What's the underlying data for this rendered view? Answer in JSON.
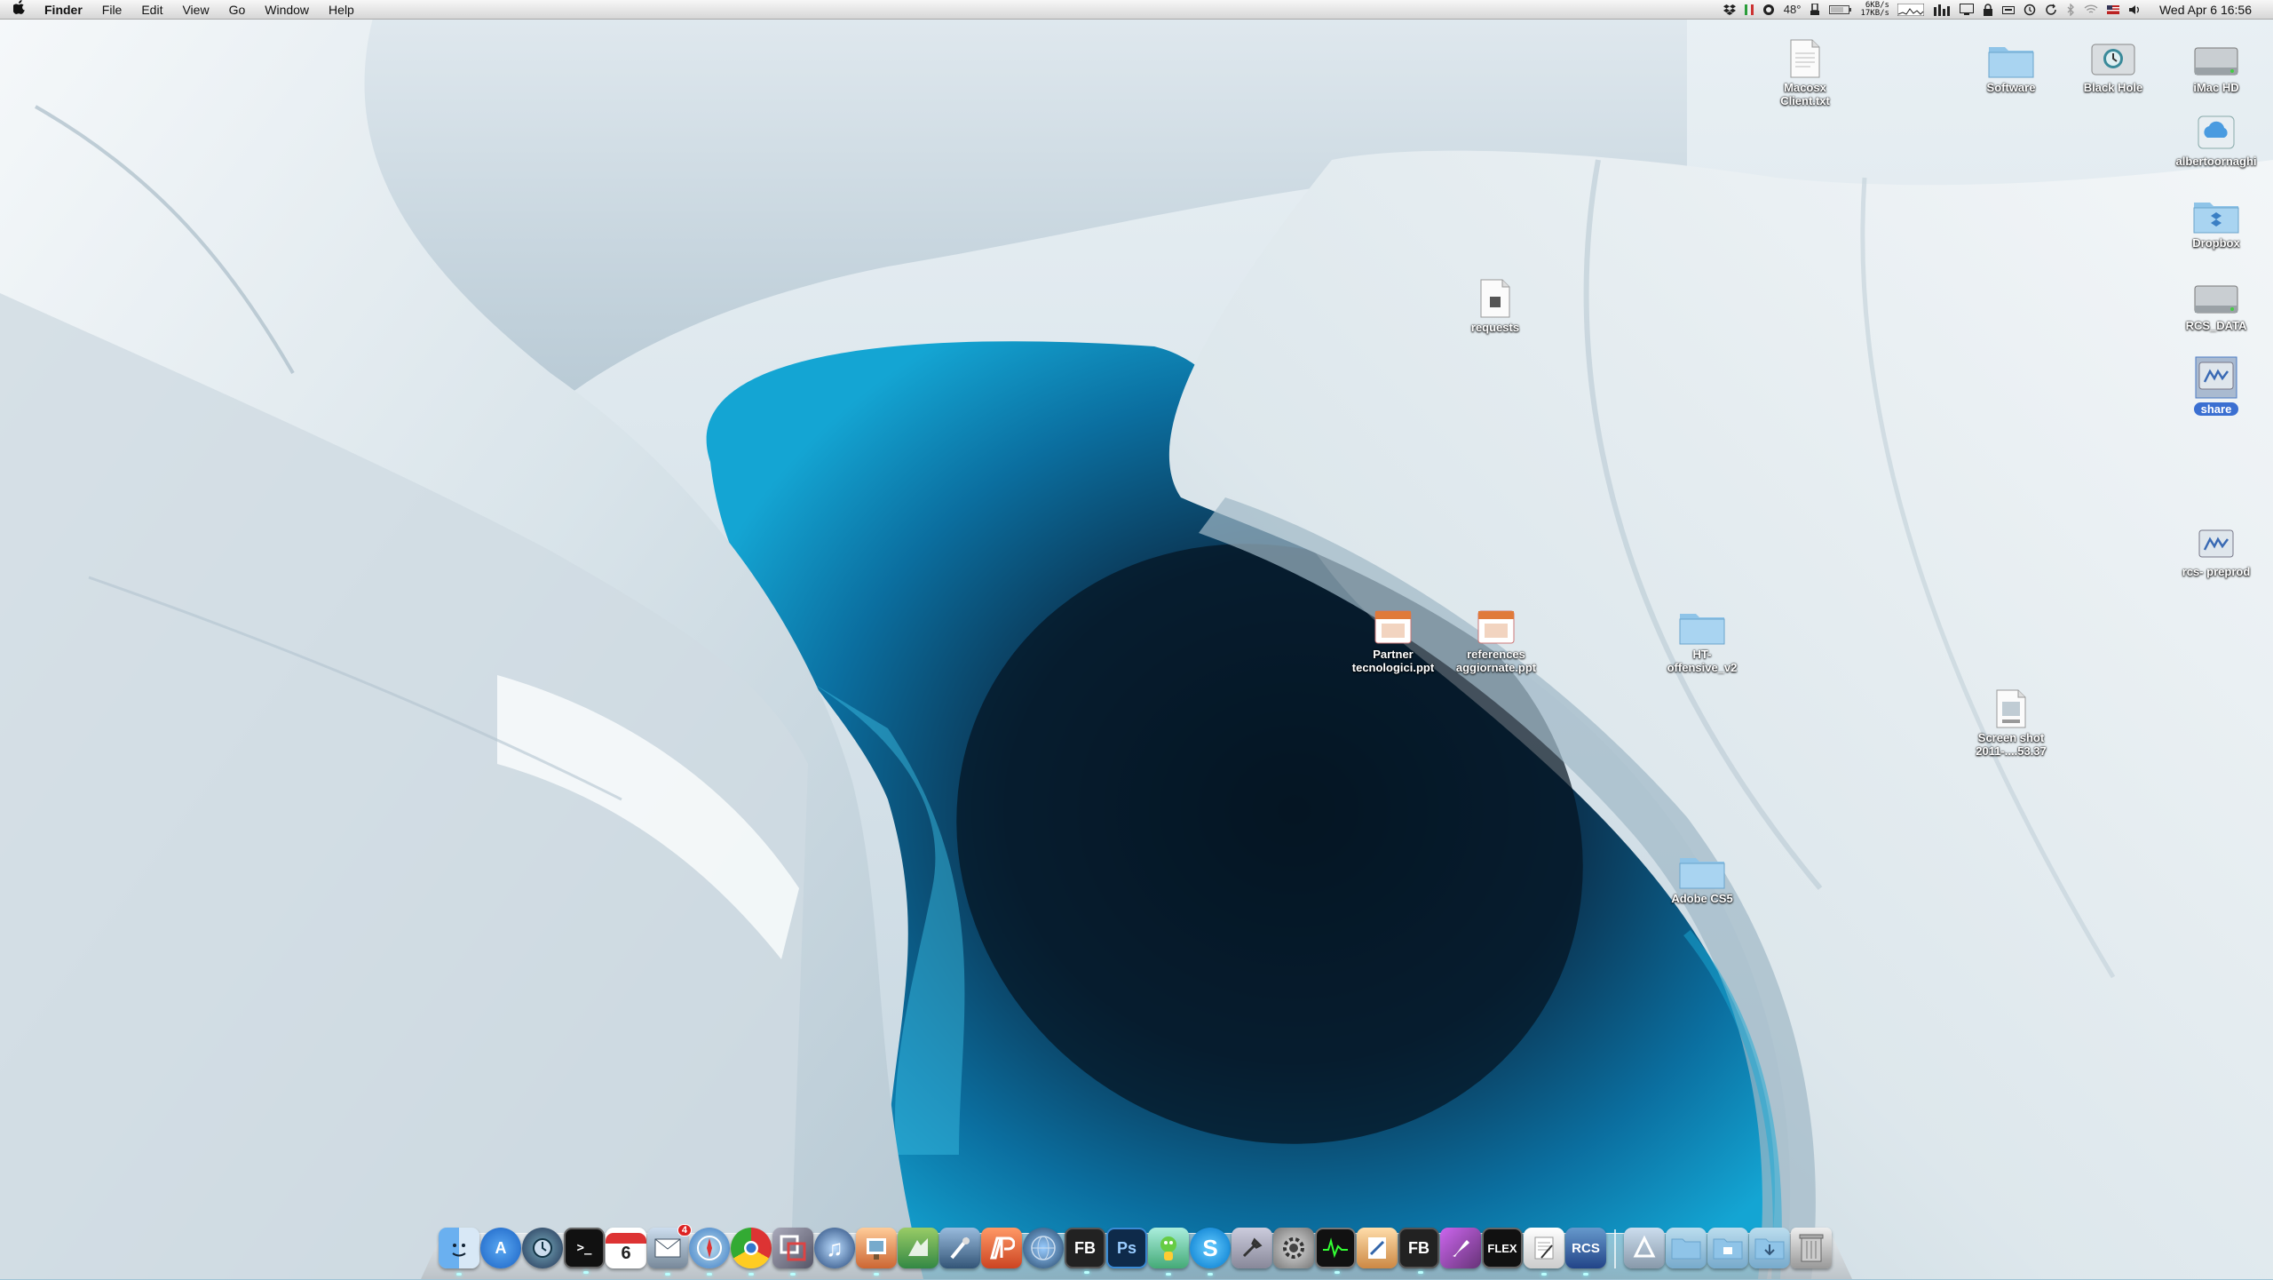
{
  "menubar": {
    "app_name": "Finder",
    "menus": [
      "File",
      "Edit",
      "View",
      "Go",
      "Window",
      "Help"
    ],
    "temperature": "48°",
    "net_up": "6KB/s",
    "net_down": "17KB/s",
    "clock": "Wed Apr 6  16:56"
  },
  "desktop": {
    "icons": [
      {
        "label": "Macosx\nClient.txt",
        "icon": "text-document-icon"
      },
      {
        "label": "Software",
        "icon": "folder-icon"
      },
      {
        "label": "Black Hole",
        "icon": "time-machine-drive-icon"
      },
      {
        "label": "iMac HD",
        "icon": "hard-drive-icon"
      },
      {
        "label": "albertoornaghi",
        "icon": "idisk-icon"
      },
      {
        "label": "Dropbox",
        "icon": "folder-icon"
      },
      {
        "label": "requests",
        "icon": "document-icon"
      },
      {
        "label": "RCS_DATA",
        "icon": "hard-drive-icon"
      },
      {
        "label": "share",
        "icon": "network-volume-icon"
      },
      {
        "label": "rcs- preprod",
        "icon": "network-volume-icon"
      },
      {
        "label": "Partner\ntecnologici.ppt",
        "icon": "presentation-file-icon"
      },
      {
        "label": "references\naggiornate.ppt",
        "icon": "presentation-file-icon"
      },
      {
        "label": "HT-\noffensive_v2",
        "icon": "folder-icon"
      },
      {
        "label": "Screen shot\n2011-....53.37",
        "icon": "png-file-icon"
      },
      {
        "label": "Adobe CS5",
        "icon": "folder-icon"
      }
    ]
  },
  "dock": {
    "calendar_day": "6",
    "mail_badge": "4",
    "items": [
      {
        "name": "Finder",
        "text": ""
      },
      {
        "name": "App Store",
        "text": "A"
      },
      {
        "name": "Time Machine",
        "text": ""
      },
      {
        "name": "Terminal",
        "text": ">_"
      },
      {
        "name": "iCal",
        "text": ""
      },
      {
        "name": "Mail",
        "text": ""
      },
      {
        "name": "Safari",
        "text": ""
      },
      {
        "name": "Chrome",
        "text": ""
      },
      {
        "name": "VMware",
        "text": ""
      },
      {
        "name": "iTunes",
        "text": "♫"
      },
      {
        "name": "Preview",
        "text": ""
      },
      {
        "name": "Coda",
        "text": ""
      },
      {
        "name": "Xcode",
        "text": ""
      },
      {
        "name": "Adobe Illustrator-like",
        "text": ""
      },
      {
        "name": "Network Globe",
        "text": ""
      },
      {
        "name": "Flash Builder",
        "text": "FB"
      },
      {
        "name": "Photoshop",
        "text": "Ps"
      },
      {
        "name": "Adium",
        "text": ""
      },
      {
        "name": "Skype",
        "text": "S"
      },
      {
        "name": "Utilities",
        "text": ""
      },
      {
        "name": "System Preferences",
        "text": ""
      },
      {
        "name": "Activity Monitor",
        "text": ""
      },
      {
        "name": "Pages",
        "text": ""
      },
      {
        "name": "Flash Builder 2",
        "text": "FB"
      },
      {
        "name": "Paint",
        "text": ""
      },
      {
        "name": "Tour de Flex",
        "text": "FLEX"
      },
      {
        "name": "TextEdit",
        "text": ""
      },
      {
        "name": "RCS",
        "text": "RCS"
      },
      {
        "name": "Applications",
        "text": ""
      },
      {
        "name": "Documents",
        "text": ""
      },
      {
        "name": "Stack",
        "text": ""
      },
      {
        "name": "Downloads",
        "text": ""
      },
      {
        "name": "Trash",
        "text": ""
      }
    ]
  }
}
